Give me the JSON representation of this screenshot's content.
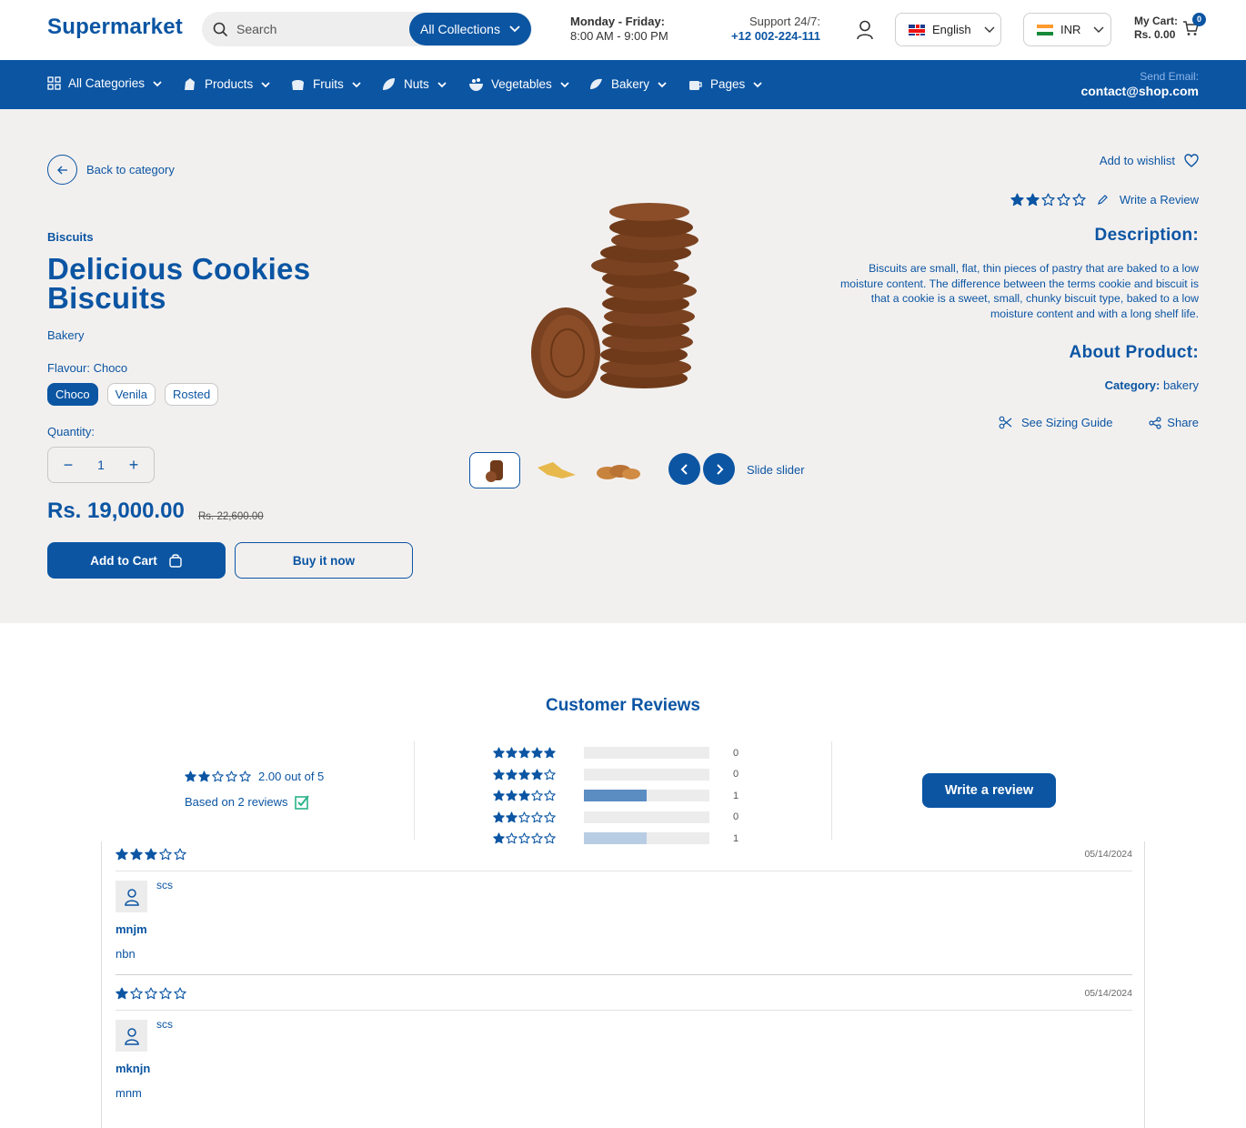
{
  "header": {
    "logo": "Supermarket",
    "search_placeholder": "Search",
    "collections_label": "All Collections",
    "hours_days": "Monday - Friday:",
    "hours_time": "8:00 AM - 9:00 PM",
    "support_label": "Support 24/7:",
    "support_phone": "+12 002-224-111",
    "language": "English",
    "currency": "INR",
    "cart_label": "My Cart:",
    "cart_total": "Rs. 0.00",
    "cart_count": "0"
  },
  "nav": {
    "items": [
      {
        "label": "All Categories",
        "icon": "grid-icon"
      },
      {
        "label": "Products",
        "icon": "milk-icon"
      },
      {
        "label": "Fruits",
        "icon": "bread-icon"
      },
      {
        "label": "Nuts",
        "icon": "nuts-icon"
      },
      {
        "label": "Vegetables",
        "icon": "bowl-icon"
      },
      {
        "label": "Bakery",
        "icon": "croissant-icon"
      },
      {
        "label": "Pages",
        "icon": "cup-icon"
      }
    ],
    "send_email_label": "Send Email:",
    "email": "contact@shop.com"
  },
  "product": {
    "back_label": "Back to category",
    "category_label": "Biscuits",
    "title": "Delicious Cookies Biscuits",
    "vendor": "Bakery",
    "flavour_label": "Flavour: Choco",
    "flavours": [
      "Choco",
      "Venila",
      "Rosted"
    ],
    "selected_flavour": "Choco",
    "quantity_label": "Quantity:",
    "quantity": "1",
    "price": "Rs. 19,000.00",
    "compare_price": "Rs. 22,600.00",
    "add_to_cart": "Add to Cart",
    "buy_now": "Buy it now",
    "slider_label": "Slide slider",
    "wishlist_label": "Add to wishlist",
    "rating": 2,
    "write_review_label": "Write a Review",
    "description_heading": "Description:",
    "description": "Biscuits are small, flat, thin pieces of pastry that are baked to a low moisture content. The difference between the terms cookie and biscuit is that a cookie is a sweet, small, chunky biscuit type, baked to a low moisture content and with a long shelf life.",
    "about_heading": "About Product:",
    "category_key": "Category:",
    "category_value": "bakery",
    "sizing_guide": "See Sizing Guide",
    "share": "Share"
  },
  "reviews": {
    "heading": "Customer Reviews",
    "average_text": "2.00 out of 5",
    "average": 2,
    "based_on": "Based on 2 reviews",
    "histogram": [
      {
        "stars": 5,
        "count": "0",
        "fraction": 0
      },
      {
        "stars": 4,
        "count": "0",
        "fraction": 0
      },
      {
        "stars": 3,
        "count": "1",
        "fraction": 0.5
      },
      {
        "stars": 2,
        "count": "0",
        "fraction": 0
      },
      {
        "stars": 1,
        "count": "1",
        "fraction": 0.5
      }
    ],
    "write_button": "Write a review",
    "items": [
      {
        "rating": 3,
        "date": "05/14/2024",
        "author": "scs",
        "title": "mnjm",
        "body": "nbn"
      },
      {
        "rating": 1,
        "date": "05/14/2024",
        "author": "scs",
        "title": "mknjn",
        "body": "mnm"
      }
    ]
  },
  "colors": {
    "brand": "#0b55a3",
    "product_bg": "#f2f0ef",
    "bar_fill_3": "#5b8cc2",
    "bar_fill_1": "#b8cde3"
  }
}
